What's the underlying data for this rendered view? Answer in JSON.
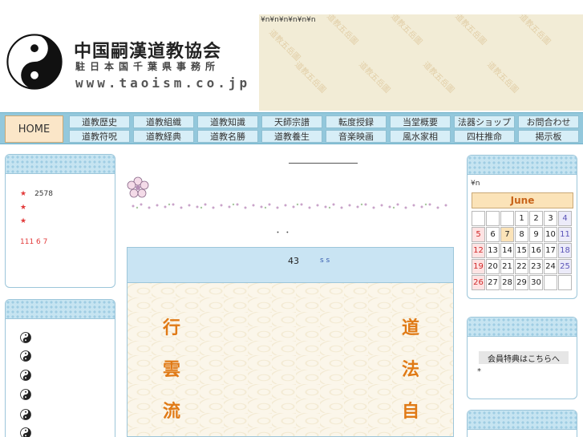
{
  "header": {
    "site_title": "中国嗣漢道教協会",
    "site_subtitle": "駐日本国千葉県事務所",
    "site_url": "www.taoism.co.jp",
    "banner_text": "¥n¥n¥n¥n¥n¥n",
    "watermark": "道教五岳圖"
  },
  "nav": {
    "home": "HOME",
    "row1": [
      "道教歴史",
      "道教組織",
      "道教知識",
      "天師宗譜",
      "転度授録",
      "当堂概要",
      "法器ショップ",
      "お問合わせ"
    ],
    "row2": [
      "道教符呪",
      "道教経典",
      "道教名勝",
      "道教養生",
      "音楽映画",
      "風水家相",
      "四柱推命",
      "掲示板"
    ],
    "colors": {
      "bar": "#93c8dc",
      "button": "#d7eef7",
      "home": "#fbe6c8"
    }
  },
  "left": {
    "counter_row": {
      "star": "★",
      "value": "2578"
    },
    "star2": "★",
    "star3": "★",
    "count_text": "111 6 7"
  },
  "center": {
    "dots": "・ ・",
    "main_num": "43",
    "main_ss": "s s",
    "kanji_left": [
      "行",
      "雲",
      "流"
    ],
    "kanji_right": [
      "道",
      "法",
      "自"
    ]
  },
  "calendar": {
    "yen_n": "¥n",
    "month": "June",
    "cells": [
      {
        "d": "",
        "t": "empty"
      },
      {
        "d": "",
        "t": "empty"
      },
      {
        "d": "",
        "t": "empty"
      },
      {
        "d": "1",
        "t": ""
      },
      {
        "d": "2",
        "t": ""
      },
      {
        "d": "3",
        "t": ""
      },
      {
        "d": "4",
        "t": "sat"
      },
      {
        "d": "5",
        "t": "sun"
      },
      {
        "d": "6",
        "t": ""
      },
      {
        "d": "7",
        "t": "today"
      },
      {
        "d": "8",
        "t": ""
      },
      {
        "d": "9",
        "t": ""
      },
      {
        "d": "10",
        "t": ""
      },
      {
        "d": "11",
        "t": "sat"
      },
      {
        "d": "12",
        "t": "sun"
      },
      {
        "d": "13",
        "t": ""
      },
      {
        "d": "14",
        "t": ""
      },
      {
        "d": "15",
        "t": ""
      },
      {
        "d": "16",
        "t": ""
      },
      {
        "d": "17",
        "t": ""
      },
      {
        "d": "18",
        "t": "sat"
      },
      {
        "d": "19",
        "t": "sun"
      },
      {
        "d": "20",
        "t": ""
      },
      {
        "d": "21",
        "t": ""
      },
      {
        "d": "22",
        "t": ""
      },
      {
        "d": "23",
        "t": ""
      },
      {
        "d": "24",
        "t": ""
      },
      {
        "d": "25",
        "t": "sat"
      },
      {
        "d": "26",
        "t": "sun"
      },
      {
        "d": "27",
        "t": ""
      },
      {
        "d": "28",
        "t": ""
      },
      {
        "d": "29",
        "t": ""
      },
      {
        "d": "30",
        "t": ""
      },
      {
        "d": "",
        "t": "empty"
      },
      {
        "d": "",
        "t": "empty"
      }
    ]
  },
  "member": {
    "link": "会員特典はこちらへ",
    "star": "*"
  }
}
